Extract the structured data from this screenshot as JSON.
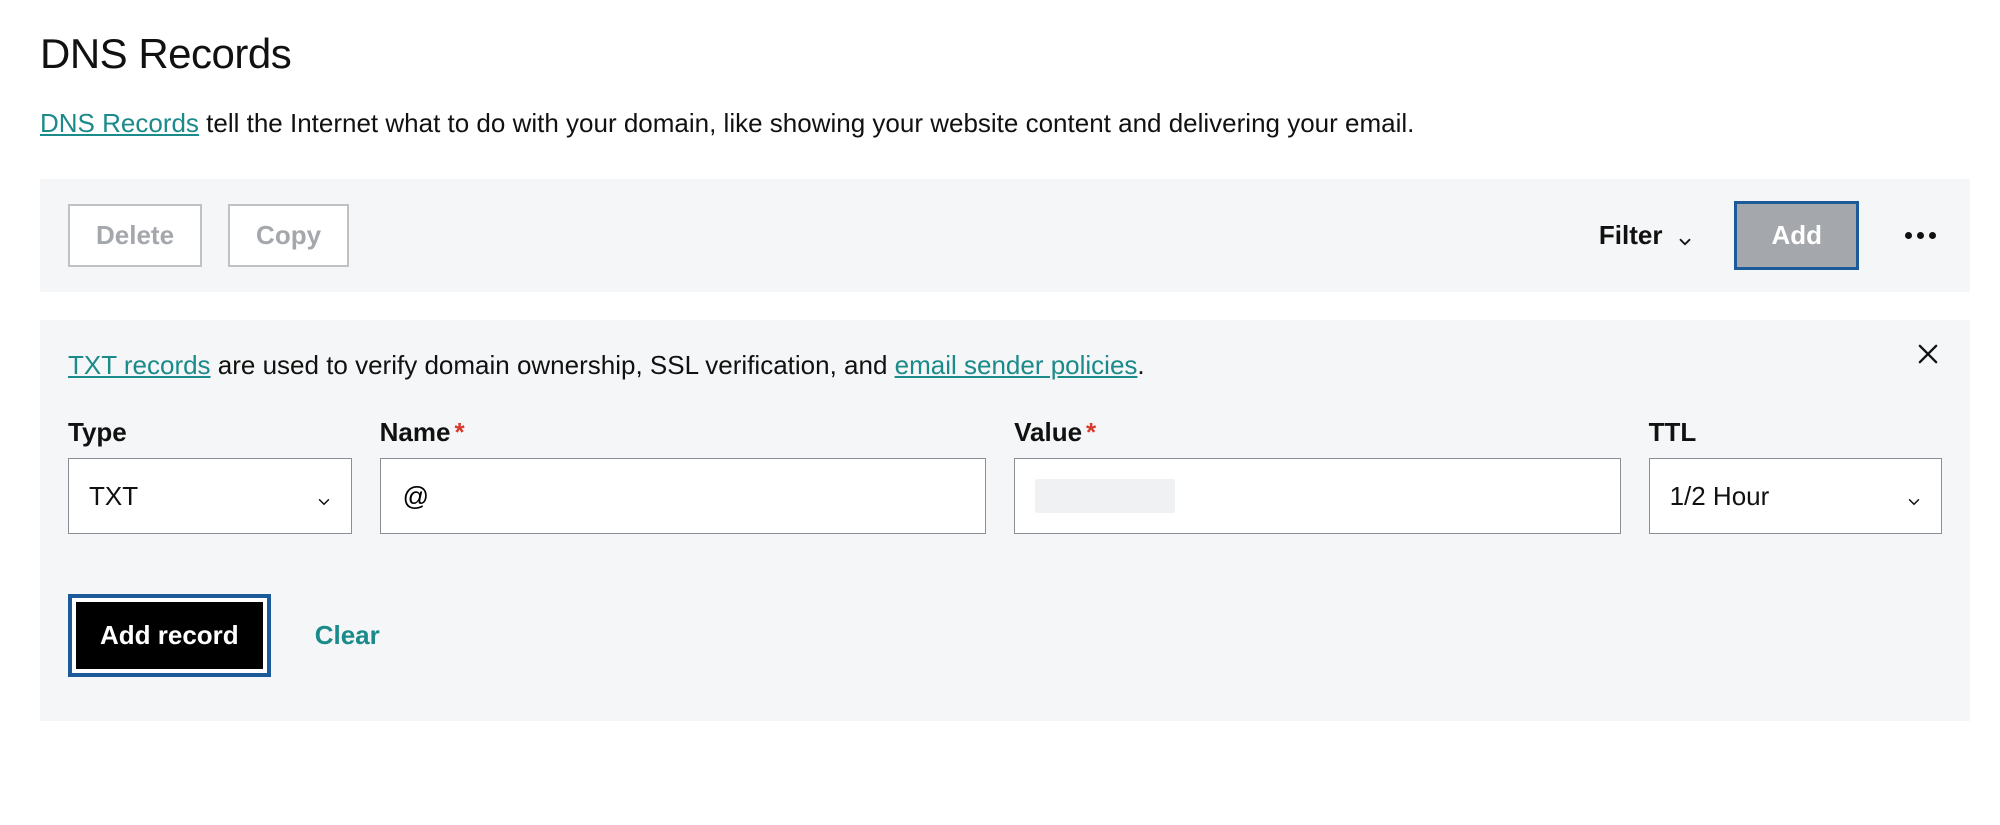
{
  "page": {
    "title": "DNS Records",
    "intro_link": "DNS Records",
    "intro_rest": " tell the Internet what to do with your domain, like showing your website content and delivering your email."
  },
  "toolbar": {
    "delete_label": "Delete",
    "copy_label": "Copy",
    "filter_label": "Filter",
    "add_label": "Add"
  },
  "panel": {
    "desc_link1": "TXT records",
    "desc_mid": " are used to verify domain ownership, SSL verification, and ",
    "desc_link2": "email sender policies",
    "desc_end": "."
  },
  "fields": {
    "type": {
      "label": "Type",
      "value": "TXT"
    },
    "name": {
      "label": "Name",
      "value": "@"
    },
    "value": {
      "label": "Value",
      "value_hidden": true
    },
    "ttl": {
      "label": "TTL",
      "value": "1/2 Hour"
    }
  },
  "actions": {
    "add_record": "Add record",
    "clear": "Clear"
  },
  "icons": {
    "chevron_down": "chevron-down-icon",
    "close": "close-icon",
    "kebab": "more-icon"
  }
}
